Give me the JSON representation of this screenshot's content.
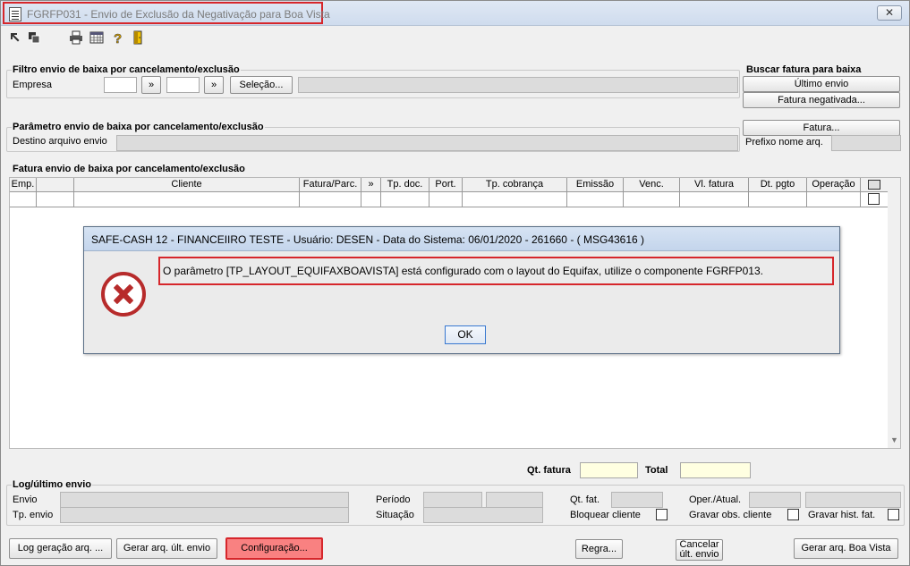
{
  "window": {
    "title": "FGRFP031 - Envio de Exclusão da Negativação para Boa Vista",
    "close_label": "✕"
  },
  "toolbar": {
    "icons": [
      "export-icon",
      "copy-icon",
      "print-icon",
      "calendar-grid-icon",
      "help-icon",
      "exit-door-icon"
    ]
  },
  "filter": {
    "title": "Filtro envio de baixa por cancelamento/exclusão",
    "empresa_label": "Empresa",
    "arrow1": "»",
    "arrow2": "»",
    "selecao_label": "Seleção..."
  },
  "buscar": {
    "title": "Buscar fatura para baixa",
    "ultimo_envio": "Último envio",
    "fatura_negativada": "Fatura negativada..."
  },
  "parametro": {
    "title": "Parâmetro envio de baixa por cancelamento/exclusão",
    "destino_label": "Destino arquivo envio",
    "fatura_button": "Fatura...",
    "prefixo_label": "Prefixo nome arq."
  },
  "fatura": {
    "title": "Fatura envio de baixa por cancelamento/exclusão",
    "columns": [
      "Emp.",
      "",
      "Cliente",
      "Fatura/Parc.",
      "»",
      "Tp. doc.",
      "Port.",
      "Tp. cobrança",
      "Emissão",
      "Venc.",
      "Vl. fatura",
      "Dt. pgto",
      "Operação"
    ]
  },
  "totals": {
    "qt_fatura_label": "Qt. fatura",
    "total_label": "Total"
  },
  "log": {
    "title": "Log/último envio",
    "envio_label": "Envio",
    "tp_envio_label": "Tp. envio",
    "periodo_label": "Período",
    "situacao_label": "Situação",
    "qt_fat_label": "Qt. fat.",
    "bloquear_label": "Bloquear cliente",
    "oper_atual_label": "Oper./Atual.",
    "gravar_obs_label": "Gravar obs. cliente",
    "gravar_hist_label": "Gravar hist. fat."
  },
  "buttons": {
    "log_geracao": "Log geração arq. ...",
    "gerar_ult_envio": "Gerar arq. últ. envio",
    "configuracao": "Configuração...",
    "regra": "Regra...",
    "cancelar_ult_envio_line1": "Cancelar",
    "cancelar_ult_envio_line2": "últ. envio",
    "gerar_boa_vista": "Gerar arq. Boa Vista"
  },
  "dialog": {
    "title": "SAFE-CASH 12 - FINANCEIIRO TESTE - Usuário: DESEN - Data do Sistema: 06/01/2020 - 261660 - ( MSG43616 )",
    "message": "O parâmetro [TP_LAYOUT_EQUIFAXBOAVISTA] está configurado com o layout do Equifax, utilize o componente FGRFP013.",
    "ok_label": "OK"
  },
  "colors": {
    "highlight": "#d6262b",
    "config_button": "#f98181",
    "yellow_field": "#ffffe1"
  }
}
